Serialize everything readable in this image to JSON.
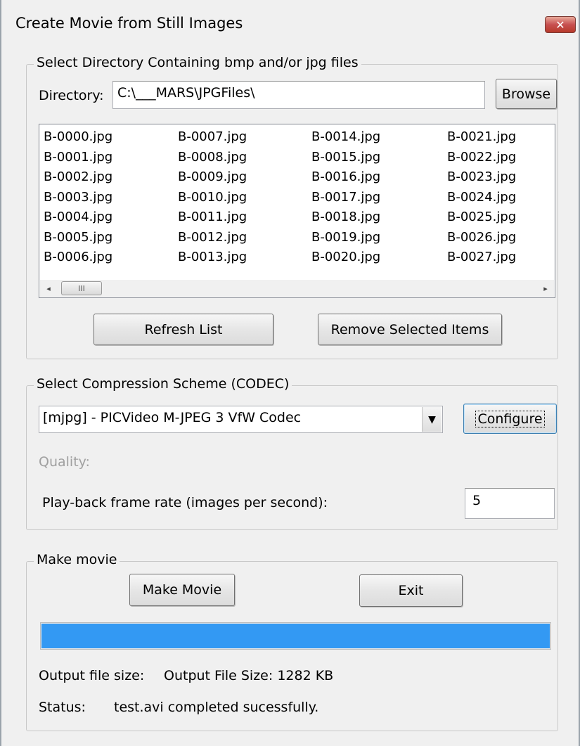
{
  "window": {
    "title": "Create Movie from Still Images",
    "close_glyph": "✕"
  },
  "directory_group": {
    "label": "Select Directory Containing bmp and/or jpg files",
    "directory_label": "Directory:",
    "directory_value": "C:\\___MARS\\JPGFiles\\",
    "browse_label": "Browse",
    "files": [
      [
        "B-0000.jpg",
        "B-0001.jpg",
        "B-0002.jpg",
        "B-0003.jpg",
        "B-0004.jpg",
        "B-0005.jpg",
        "B-0006.jpg"
      ],
      [
        "B-0007.jpg",
        "B-0008.jpg",
        "B-0009.jpg",
        "B-0010.jpg",
        "B-0011.jpg",
        "B-0012.jpg",
        "B-0013.jpg"
      ],
      [
        "B-0014.jpg",
        "B-0015.jpg",
        "B-0016.jpg",
        "B-0017.jpg",
        "B-0018.jpg",
        "B-0019.jpg",
        "B-0020.jpg"
      ],
      [
        "B-0021.jpg",
        "B-0022.jpg",
        "B-0023.jpg",
        "B-0024.jpg",
        "B-0025.jpg",
        "B-0026.jpg",
        "B-0027.jpg"
      ]
    ],
    "scroll_thumb_grip": "III",
    "scroll_left_glyph": "◂",
    "scroll_right_glyph": "▸",
    "refresh_label": "Refresh List",
    "remove_label": "Remove Selected Items"
  },
  "codec_group": {
    "label": "Select Compression Scheme (CODEC)",
    "codec_selected": "[mjpg] - PICVideo M-JPEG 3 VfW Codec",
    "dropdown_glyph": "▼",
    "configure_label": "Configure",
    "quality_label": "Quality:",
    "framerate_label": "Play-back frame rate (images per second):",
    "framerate_value": "5"
  },
  "movie_group": {
    "label": "Make movie",
    "make_movie_label": "Make Movie",
    "exit_label": "Exit",
    "progress_fraction": 1.0,
    "output_size_label": "Output file size:",
    "output_size_value": "Output File Size:  1282 KB",
    "status_label": "Status:",
    "status_value": "test.avi completed sucessfully."
  },
  "colors": {
    "progress_fill": "#3399f3",
    "disabled_text": "#a0a0a0",
    "close_button": "#c75050"
  }
}
